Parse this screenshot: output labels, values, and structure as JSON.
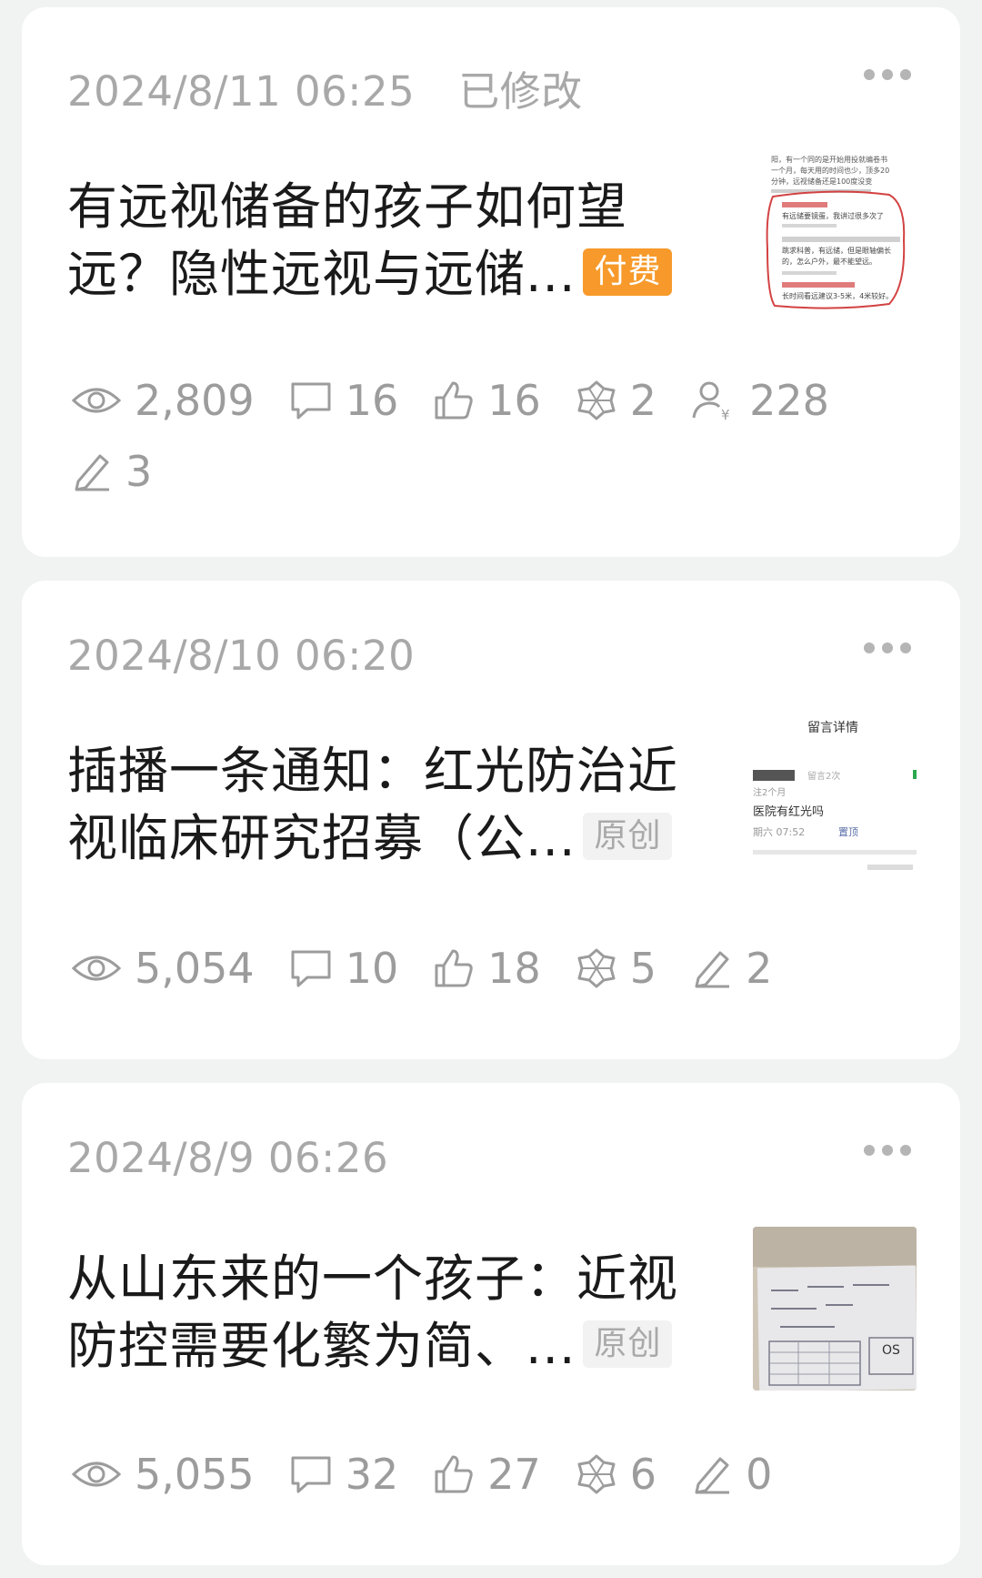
{
  "articles": [
    {
      "date": "2024/8/11 06:25",
      "status": "已修改",
      "title_line1": "有远视储备的孩子如何望",
      "title_line2": "远？隐性远视与远储...",
      "badge": "付费",
      "stats": {
        "views": "2,809",
        "comments": "16",
        "likes": "16",
        "shares": "2",
        "rewards": "228",
        "edits": "3"
      },
      "thumb_lines": [
        "阳，有一个同的是开始用投就编卷书",
        "一个月，每天用的时间也少，顶多20",
        "分钟，远视储备还是100度没变",
        "有远储要镜蛋，我讲过很多次了",
        "跳求科普，有远储，但是眼轴偏长",
        "的，怎么户外，最不能望远。",
        "长时间看远建议3-5米，4米较好。"
      ]
    },
    {
      "date": "2024/8/10 06:20",
      "status": "",
      "title_line1": "插播一条通知：红光防治近",
      "title_line2": "视临床研究招募（公...",
      "badge": "原创",
      "stats": {
        "views": "5,054",
        "comments": "10",
        "likes": "18",
        "shares": "5",
        "edits": "2"
      },
      "thumb_lines": [
        "留言详情",
        "留言2次",
        "注2个月",
        "医院有红光吗",
        "期六 07:52",
        "置顶"
      ]
    },
    {
      "date": "2024/8/9 06:26",
      "status": "",
      "title_line1": "从山东来的一个孩子：近视",
      "title_line2": "防控需要化繁为简、...",
      "badge": "原创",
      "stats": {
        "views": "5,055",
        "comments": "32",
        "likes": "27",
        "shares": "6",
        "edits": "0"
      },
      "thumb_lines": [
        "OS"
      ]
    }
  ],
  "colors": {
    "badge_paid": "#f79a2b",
    "badge_original_bg": "#f2f2f2",
    "meta_text": "#a8a8a8",
    "title_text": "#1a1a1a",
    "background": "#f0f3f2"
  },
  "icons": [
    "eye-icon",
    "comment-icon",
    "thumbs-up-icon",
    "share-icon",
    "reward-icon",
    "pen-icon",
    "more-icon"
  ]
}
